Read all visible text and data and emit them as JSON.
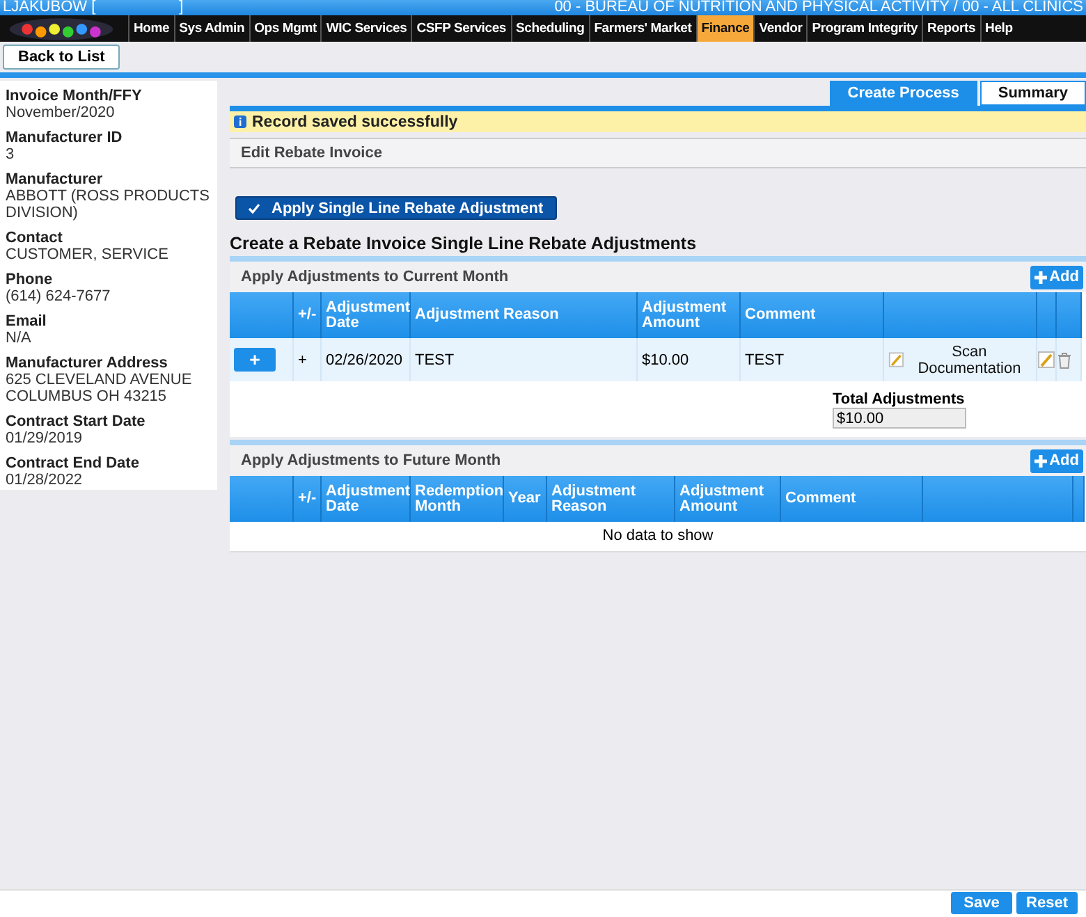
{
  "header": {
    "user": "LJAKUBOW [",
    "user_end": "]",
    "agency": "00 - BUREAU OF NUTRITION AND PHYSICAL ACTIVITY / 00 - ALL CLINICS"
  },
  "nav": [
    {
      "label": "Home",
      "selected": false
    },
    {
      "label": "Sys Admin",
      "selected": false
    },
    {
      "label": "Ops Mgmt",
      "selected": false
    },
    {
      "label": "WIC Services",
      "selected": false
    },
    {
      "label": "CSFP Services",
      "selected": false
    },
    {
      "label": "Scheduling",
      "selected": false
    },
    {
      "label": "Farmers' Market",
      "selected": false
    },
    {
      "label": "Finance",
      "selected": true
    },
    {
      "label": "Vendor",
      "selected": false
    },
    {
      "label": "Program Integrity",
      "selected": false
    },
    {
      "label": "Reports",
      "selected": false
    },
    {
      "label": "Help",
      "selected": false
    }
  ],
  "back_button": "Back to List",
  "details": [
    {
      "label": "Invoice Month/FFY",
      "value": "November/2020"
    },
    {
      "label": "Manufacturer ID",
      "value": "3"
    },
    {
      "label": "Manufacturer",
      "value": "ABBOTT (ROSS PRODUCTS DIVISION)"
    },
    {
      "label": "Contact",
      "value": "CUSTOMER, SERVICE"
    },
    {
      "label": "Phone",
      "value": "(614) 624-7677"
    },
    {
      "label": "Email",
      "value": "N/A"
    },
    {
      "label": "Manufacturer Address",
      "value": "625 CLEVELAND AVENUE COLUMBUS OH 43215"
    },
    {
      "label": "Contract Start Date",
      "value": "01/29/2019"
    },
    {
      "label": "Contract End Date",
      "value": "01/28/2022"
    }
  ],
  "tabs": [
    {
      "label": "Create Process",
      "selected": true
    },
    {
      "label": "Summary",
      "selected": false
    }
  ],
  "message": "Record saved successfully",
  "section_title": "Edit Rebate Invoice",
  "apply_button": "Apply Single Line Rebate Adjustment",
  "heading": "Create a Rebate Invoice Single Line Rebate Adjustments",
  "current": {
    "title": "Apply Adjustments to Current Month",
    "add": "Add",
    "columns": [
      "+/-",
      "Adjustment Date",
      "Adjustment Reason",
      "Adjustment Amount",
      "Comment"
    ],
    "rows": [
      {
        "expand": "+",
        "sign": "+",
        "date": "02/26/2020",
        "reason": "TEST",
        "amount": "$10.00",
        "comment": "TEST",
        "scan": "Scan Documentation"
      }
    ],
    "total_label": "Total Adjustments",
    "total": "$10.00"
  },
  "future": {
    "title": "Apply Adjustments to Future Month",
    "add": "Add",
    "columns": [
      "+/-",
      "Adjustment Date",
      "Redemption Month",
      "Year",
      "Adjustment Reason",
      "Adjustment Amount",
      "Comment"
    ],
    "empty": "No data to show"
  },
  "footer": {
    "save": "Save",
    "reset": "Reset"
  }
}
